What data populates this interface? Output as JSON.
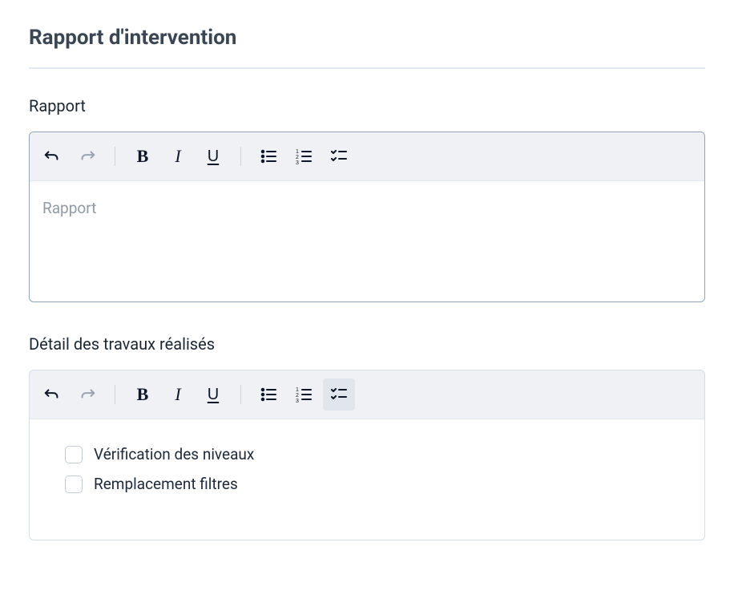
{
  "section_title": "Rapport d'intervention",
  "rapport": {
    "label": "Rapport",
    "placeholder": "Rapport",
    "value": ""
  },
  "detail": {
    "label": "Détail des travaux réalisés",
    "checklist": [
      {
        "text": "Vérification des niveaux",
        "checked": false
      },
      {
        "text": "Remplacement filtres",
        "checked": false
      }
    ]
  },
  "toolbar_icons": {
    "undo": "undo-icon",
    "redo": "redo-icon",
    "bold": "B",
    "italic": "I",
    "underline": "U",
    "bullet": "bullet-list-icon",
    "number": "number-list-icon",
    "check": "check-list-icon"
  }
}
